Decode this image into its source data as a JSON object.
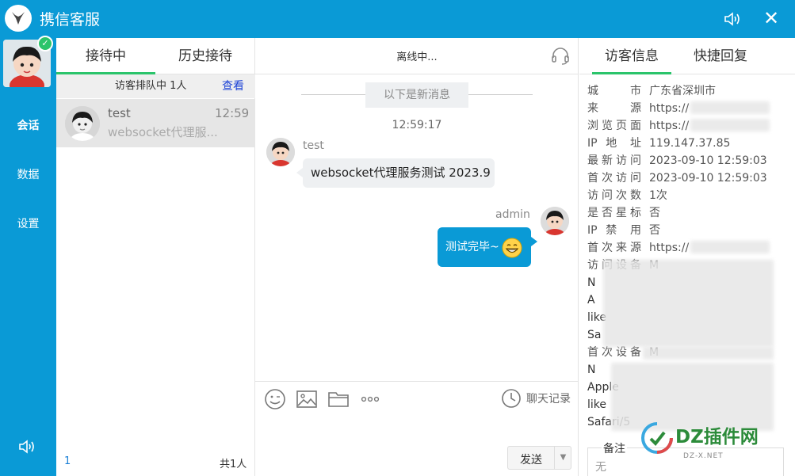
{
  "titlebar": {
    "title": "携信客服",
    "close_label": "✕"
  },
  "rail": {
    "online_mark": "✓",
    "nav": [
      {
        "label": "会话",
        "active": true
      },
      {
        "label": "数据",
        "active": false
      },
      {
        "label": "设置",
        "active": false
      }
    ]
  },
  "sessions": {
    "tabs": [
      {
        "label": "接待中",
        "active": true
      },
      {
        "label": "历史接待",
        "active": false
      }
    ],
    "queue_text": "访客排队中 1人",
    "queue_link": "查看",
    "items": [
      {
        "name": "test",
        "time": "12:59",
        "preview": "websocket代理服..."
      }
    ],
    "page": "1",
    "total": "共1人"
  },
  "chat": {
    "status": "离线中...",
    "new_messages_label": "以下是新消息",
    "timestamp": "12:59:17",
    "messages": [
      {
        "sender": "test",
        "text": "websocket代理服务测试 2023.9",
        "direction": "in"
      },
      {
        "sender": "admin",
        "text": "测试完毕~",
        "direction": "out",
        "emoji": "grinning-face"
      }
    ],
    "history_label": "聊天记录",
    "send_label": "发送",
    "send_caret": "▼"
  },
  "info": {
    "tabs": [
      {
        "label": "访客信息",
        "active": true
      },
      {
        "label": "快捷回复",
        "active": false
      }
    ],
    "rows": [
      {
        "k": "城　　市",
        "v": "广东省深圳市"
      },
      {
        "k": "来　　源",
        "v": "https://"
      },
      {
        "k": "浏览页面",
        "v": "https://"
      },
      {
        "k": "IP 地 址",
        "v": "119.147.37.85"
      },
      {
        "k": "最新访问",
        "v": "2023-09-10 12:59:03"
      },
      {
        "k": "首次访问",
        "v": "2023-09-10 12:59:03"
      },
      {
        "k": "访问次数",
        "v": "1次"
      },
      {
        "k": "是否星标",
        "v": "否"
      },
      {
        "k": "IP 禁 用",
        "v": "否"
      },
      {
        "k": "首次来源",
        "v": "https://"
      },
      {
        "k": "访问设备",
        "v": "M"
      }
    ],
    "ua_lines": [
      "N",
      "A",
      "like",
      "Sa"
    ],
    "first_device_key": "首次设备",
    "first_device_val": "M",
    "ua_lines2": [
      "N",
      "Apple",
      "like",
      "Safari/5"
    ],
    "note_label": "备注",
    "note_value": "无"
  },
  "watermark": {
    "text": "DZ插件网",
    "sub": "DZ-X.NET"
  },
  "colors": {
    "brand": "#0a9ad6",
    "accent": "#2bc46b",
    "link": "#1a41d6"
  }
}
